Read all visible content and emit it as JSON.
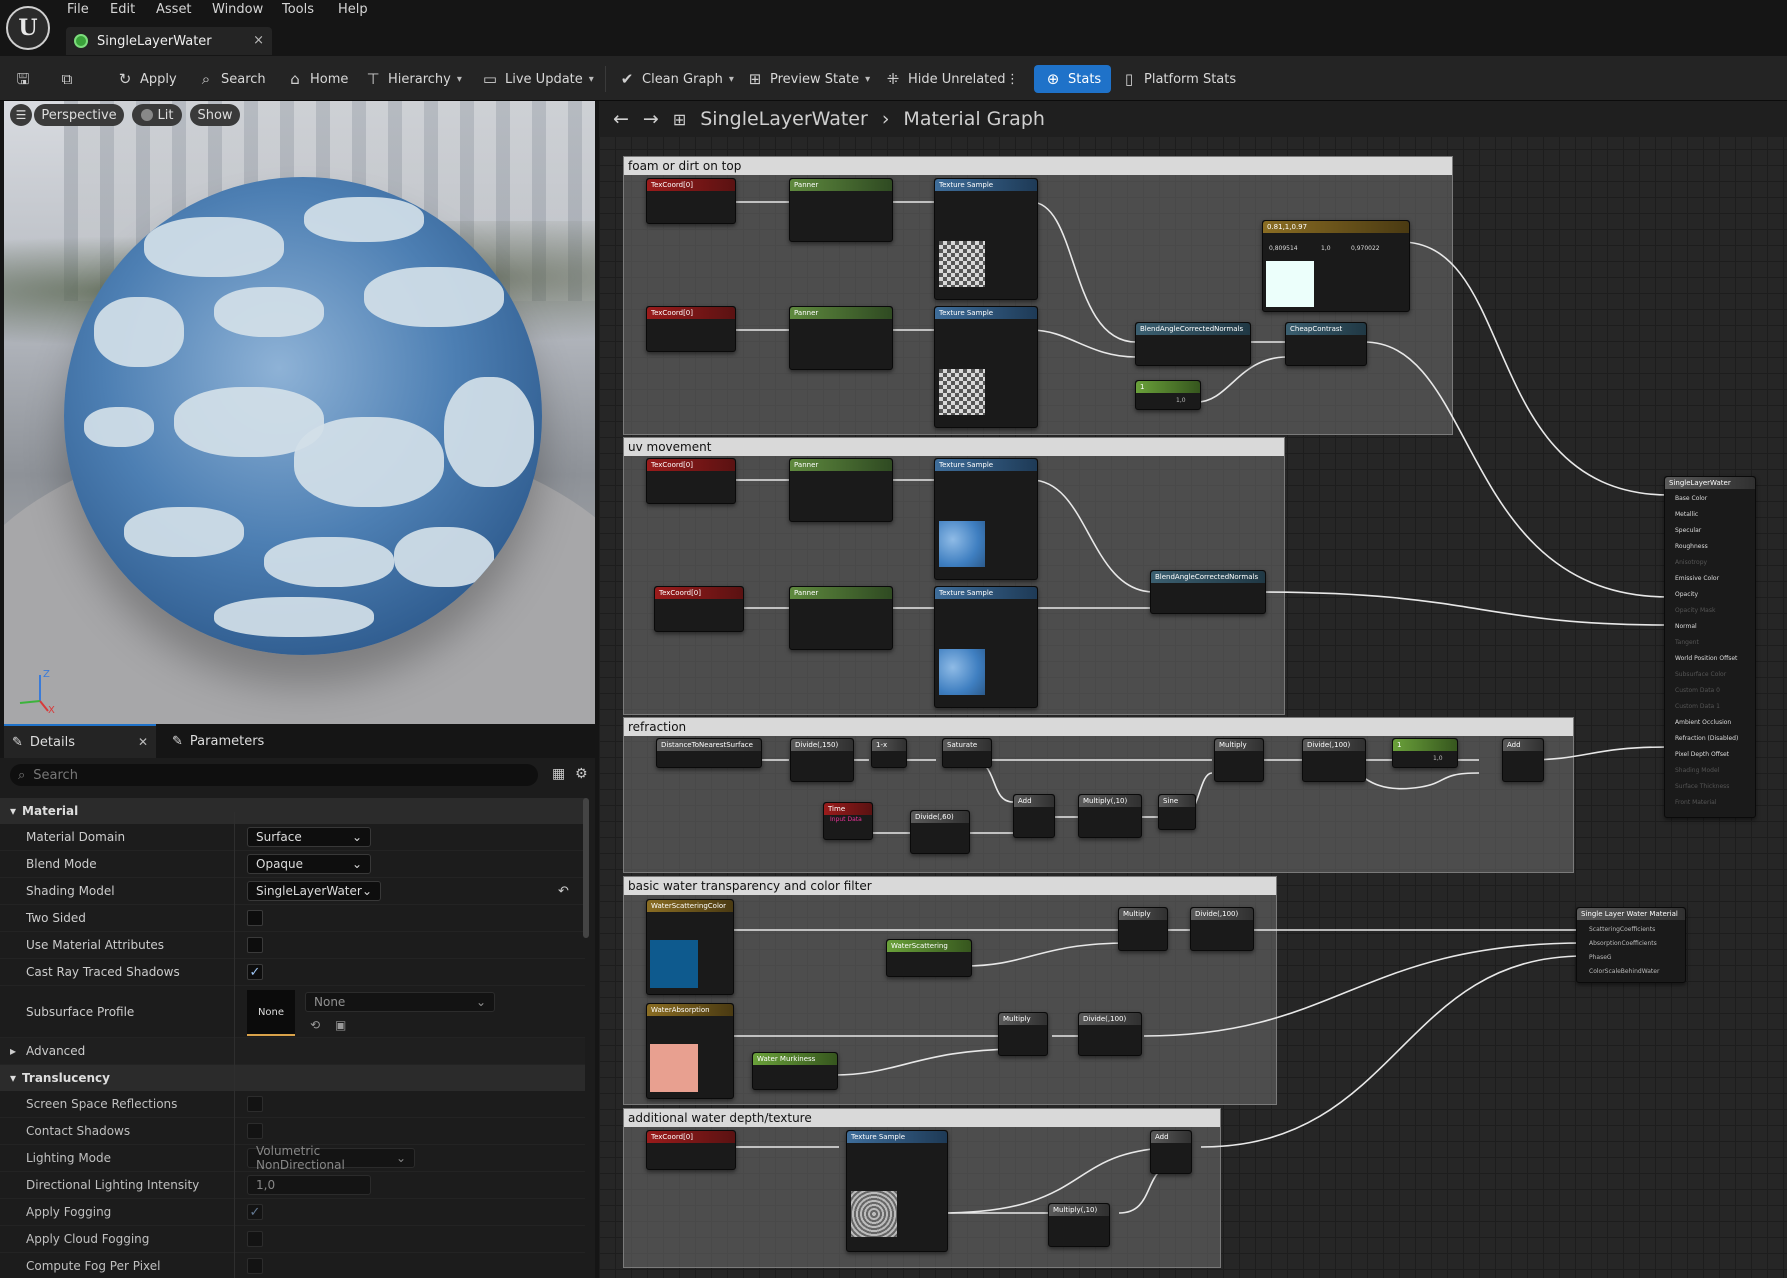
{
  "menu": [
    "File",
    "Edit",
    "Asset",
    "Window",
    "Tools",
    "Help"
  ],
  "tab": {
    "title": "SingleLayerWater",
    "close": "×"
  },
  "toolbar": {
    "apply": "Apply",
    "search": "Search",
    "home": "Home",
    "hierarchy": "Hierarchy",
    "live_update": "Live Update",
    "clean_graph": "Clean Graph",
    "preview_state": "Preview State",
    "hide_unrelated": "Hide Unrelated",
    "stats": "Stats",
    "platform_stats": "Platform Stats"
  },
  "viewport": {
    "perspective": "Perspective",
    "lit": "Lit",
    "show": "Show"
  },
  "details": {
    "tab_details": "Details",
    "tab_params": "Parameters",
    "search_placeholder": "Search",
    "cat_material": "Material",
    "material_domain": {
      "label": "Material Domain",
      "value": "Surface"
    },
    "blend_mode": {
      "label": "Blend Mode",
      "value": "Opaque"
    },
    "shading_model": {
      "label": "Shading Model",
      "value": "SingleLayerWater"
    },
    "two_sided": {
      "label": "Two Sided",
      "checked": false
    },
    "use_material_attributes": {
      "label": "Use Material Attributes",
      "checked": false
    },
    "cast_ray_traced_shadows": {
      "label": "Cast Ray Traced Shadows",
      "checked": true
    },
    "subsurface_profile": {
      "label": "Subsurface Profile",
      "thumb": "None",
      "value": "None"
    },
    "advanced": "Advanced",
    "cat_translucency": "Translucency",
    "screen_space_reflections": "Screen Space Reflections",
    "contact_shadows": "Contact Shadows",
    "lighting_mode": {
      "label": "Lighting Mode",
      "value": "Volumetric NonDirectional"
    },
    "directional_lighting_intensity": {
      "label": "Directional Lighting Intensity",
      "value": "1,0"
    },
    "apply_fogging": {
      "label": "Apply Fogging",
      "checked": true
    },
    "apply_cloud_fogging": "Apply Cloud Fogging",
    "compute_fog_per_pixel": "Compute Fog Per Pixel"
  },
  "graph": {
    "breadcrumb_asset": "SingleLayerWater",
    "breadcrumb_graph": "Material Graph",
    "comments": {
      "foam": "foam or dirt on top",
      "uv": "uv movement",
      "refraction": "refraction",
      "basic": "basic water transparency and color filter",
      "depth": "additional water depth/texture"
    },
    "nodes": {
      "texcoord": "TexCoord[0]",
      "panner": "Panner",
      "texture_sample": "Texture Sample",
      "blend_normals": "BlendAngleCorrectedNormals",
      "cheap_contrast": "CheapContrast",
      "constant3": "0.81,1,0.97",
      "constant_vals": [
        "0,809514",
        "1,0",
        "0,970022"
      ],
      "one": "1",
      "one_value": "1,0",
      "distance": "DistanceToNearestSurface",
      "divide150": "Divide(,150)",
      "oneminus": "1-x",
      "saturate": "Saturate",
      "multiply": "Multiply",
      "divide100": "Divide(,100)",
      "add": "Add",
      "time": "Time",
      "time_sub": "Input Data",
      "divide60": "Divide(,60)",
      "multiply10": "Multiply(,10)",
      "sine": "Sine",
      "water_scattering_color": "WaterScatteringColor",
      "water_scattering": "WaterScattering",
      "water_absorption": "WaterAbsorption",
      "water_murkiness": "Water Murkiness",
      "slw_material": "Single Layer Water Material",
      "result": "SingleLayerWater"
    },
    "result_pins": [
      "Base Color",
      "Metallic",
      "Specular",
      "Roughness",
      "Anisotropy",
      "Emissive Color",
      "Opacity",
      "Opacity Mask",
      "Normal",
      "Tangent",
      "World Position Offset",
      "Subsurface Color",
      "Custom Data 0",
      "Custom Data 1",
      "Ambient Occlusion",
      "Refraction (Disabled)",
      "Pixel Depth Offset",
      "Shading Model",
      "Surface Thickness",
      "Front Material"
    ],
    "slw_pins": [
      "ScatteringCoefficients",
      "AbsorptionCoefficients",
      "PhaseG",
      "ColorScaleBehindWater"
    ],
    "colors": {
      "scattering": "#0e5a8e",
      "absorption": "#e8a090",
      "constant": "#ecfffb"
    }
  }
}
